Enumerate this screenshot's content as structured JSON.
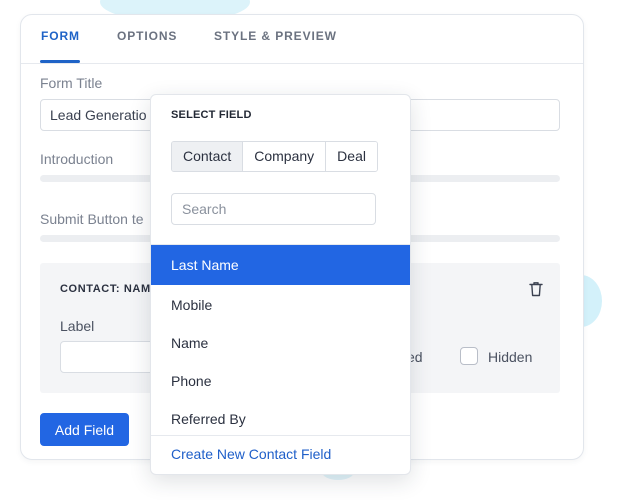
{
  "tabs": [
    {
      "label": "FORM",
      "active": true
    },
    {
      "label": "OPTIONS",
      "active": false
    },
    {
      "label": "STYLE & PREVIEW",
      "active": false
    }
  ],
  "form": {
    "title_label": "Form Title",
    "title_value": "Lead Generatio",
    "intro_label": "Introduction",
    "submit_label": "Submit Button te"
  },
  "section": {
    "title": "CONTACT: NAM",
    "label": "Label",
    "required_fragment": "ed",
    "hidden_label": "Hidden"
  },
  "add_field_label": "Add Field",
  "popover": {
    "title": "SELECT FIELD",
    "segments": [
      {
        "label": "Contact",
        "active": true
      },
      {
        "label": "Company",
        "active": false
      },
      {
        "label": "Deal",
        "active": false
      }
    ],
    "search_placeholder": "Search",
    "items": [
      {
        "label": "Last Name",
        "selected": true
      },
      {
        "label": "Mobile",
        "selected": false
      },
      {
        "label": "Name",
        "selected": false
      },
      {
        "label": "Phone",
        "selected": false
      },
      {
        "label": "Referred By",
        "selected": false
      }
    ],
    "footer_link": "Create New Contact Field"
  },
  "colors": {
    "accent": "#2266e3",
    "active_tab": "#1f63c7",
    "link": "#1f5fc9"
  },
  "icons": {
    "delete": "trash-icon"
  }
}
